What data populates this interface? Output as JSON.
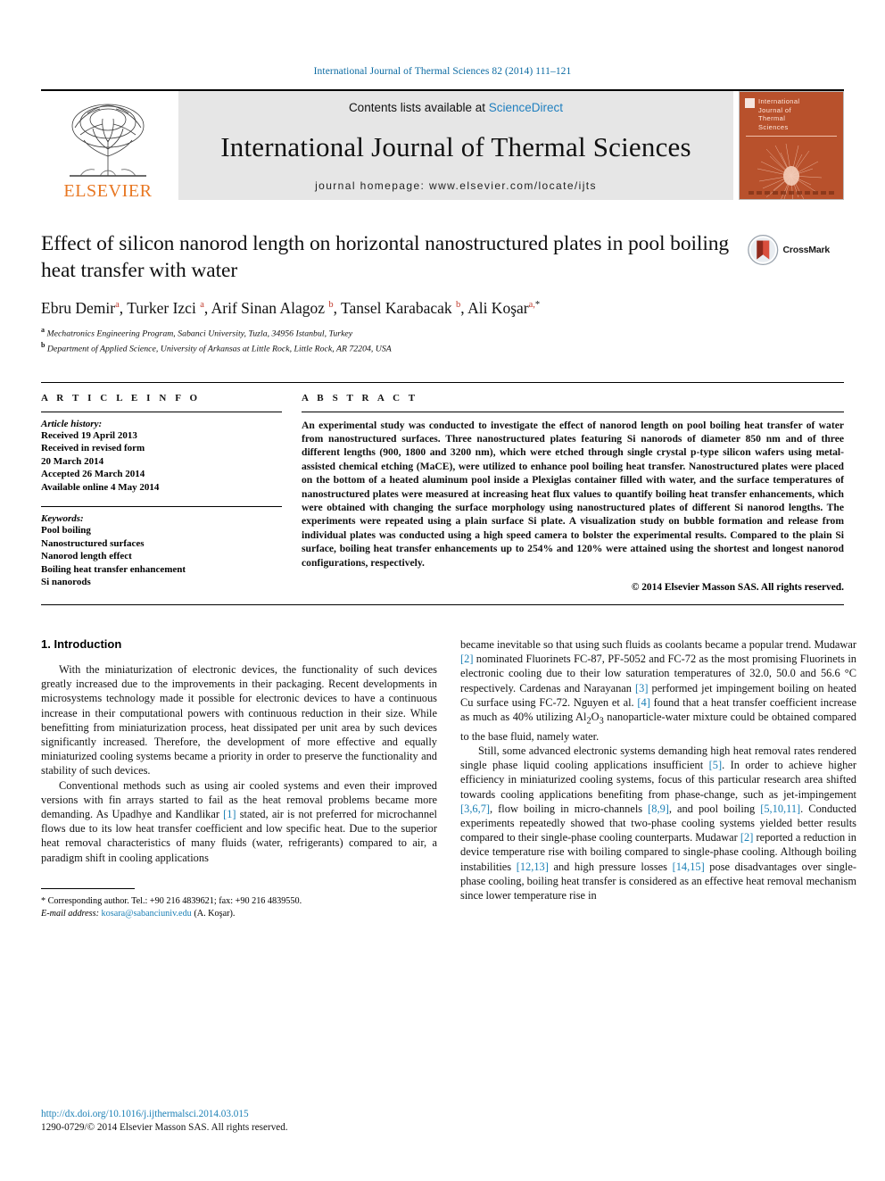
{
  "running_head": "International Journal of Thermal Sciences 82 (2014) 111–121",
  "masthead": {
    "publisher_name": "ELSEVIER",
    "contents_prefix": "Contents lists available at ",
    "contents_link": "ScienceDirect",
    "journal_title": "International Journal of Thermal Sciences",
    "homepage_line": "journal homepage: www.elsevier.com/locate/ijts",
    "cover_title_lines": [
      "International",
      "Journal of",
      "Thermal",
      "Sciences"
    ]
  },
  "article": {
    "title": "Effect of silicon nanorod length on horizontal nanostructured plates in pool boiling heat transfer with water",
    "crossmark_label": "CrossMark",
    "authors_html": "Ebru Demir<sup>a</sup>, Turker Izci <sup>a</sup>, Arif Sinan Alagoz <sup>b</sup>, Tansel Karabacak <sup>b</sup>, Ali Koşar<sup>a,</sup><sup class=\"star\">*</sup>",
    "affiliations": [
      "<sup>a</sup> Mechatronics Engineering Program, Sabanci University, Tuzla, 34956 Istanbul, Turkey",
      "<sup>b</sup> Department of Applied Science, University of Arkansas at Little Rock, Little Rock, AR 72204, USA"
    ]
  },
  "info": {
    "heading": "A R T I C L E   I N F O",
    "history_label": "Article history:",
    "history_lines": [
      "Received 19 April 2013",
      "Received in revised form",
      "20 March 2014",
      "Accepted 26 March 2014",
      "Available online 4 May 2014"
    ],
    "keywords_label": "Keywords:",
    "keywords": [
      "Pool boiling",
      "Nanostructured surfaces",
      "Nanorod length effect",
      "Boiling heat transfer enhancement",
      "Si nanorods"
    ]
  },
  "abstract": {
    "heading": "A B S T R A C T",
    "text": "An experimental study was conducted to investigate the effect of nanorod length on pool boiling heat transfer of water from nanostructured surfaces. Three nanostructured plates featuring Si nanorods of diameter 850 nm and of three different lengths (900, 1800 and 3200 nm), which were etched through single crystal p-type silicon wafers using metal-assisted chemical etching (MaCE), were utilized to enhance pool boiling heat transfer. Nanostructured plates were placed on the bottom of a heated aluminum pool inside a Plexiglas container filled with water, and the surface temperatures of nanostructured plates were measured at increasing heat flux values to quantify boiling heat transfer enhancements, which were obtained with changing the surface morphology using nanostructured plates of different Si nanorod lengths. The experiments were repeated using a plain surface Si plate. A visualization study on bubble formation and release from individual plates was conducted using a high speed camera to bolster the experimental results. Compared to the plain Si surface, boiling heat transfer enhancements up to 254% and 120% were attained using the shortest and longest nanorod configurations, respectively.",
    "copyright": "© 2014 Elsevier Masson SAS. All rights reserved."
  },
  "body": {
    "section_number_title": "1.  Introduction",
    "left_paragraphs_html": [
      "With the miniaturization of electronic devices, the functionality of such devices greatly increased due to the improvements in their packaging. Recent developments in microsystems technology made it possible for electronic devices to have a continuous increase in their computational powers with continuous reduction in their size. While benefitting from miniaturization process, heat dissipated per unit area by such devices significantly increased. Therefore, the development of more effective and equally miniaturized cooling systems became a priority in order to preserve the functionality and stability of such devices.",
      "Conventional methods such as using air cooled systems and even their improved versions with fin arrays started to fail as the heat removal problems became more demanding. As Upadhye and Kandlikar <span class=\"ref\">[1]</span> stated, air is not preferred for microchannel flows due to its low heat transfer coefficient and low specific heat. Due to the superior heat removal characteristics of many fluids (water, refrigerants) compared to air, a paradigm shift in cooling applications"
    ],
    "right_paragraphs_html": [
      "became inevitable so that using such fluids as coolants became a popular trend. Mudawar <span class=\"ref\">[2]</span> nominated Fluorinets FC-87, PF-5052 and FC-72 as the most promising Fluorinets in electronic cooling due to their low saturation temperatures of 32.0, 50.0 and 56.6 °C respectively. Cardenas and Narayanan <span class=\"ref\">[3]</span> performed jet impingement boiling on heated Cu surface using FC-72. Nguyen et al. <span class=\"ref\">[4]</span> found that a heat transfer coefficient increase as much as 40% utilizing Al<sub>2</sub>O<sub>3</sub> nanoparticle-water mixture could be obtained compared to the base fluid, namely water.",
      "Still, some advanced electronic systems demanding high heat removal rates rendered single phase liquid cooling applications insufficient <span class=\"ref\">[5]</span>. In order to achieve higher efficiency in miniaturized cooling systems, focus of this particular research area shifted towards cooling applications benefiting from phase-change, such as jet-impingement <span class=\"ref\">[3,6,7]</span>, flow boiling in micro-channels <span class=\"ref\">[8,9]</span>, and pool boiling <span class=\"ref\">[5,10,11]</span>. Conducted experiments repeatedly showed that two-phase cooling systems yielded better results compared to their single-phase cooling counterparts. Mudawar <span class=\"ref\">[2]</span> reported a reduction in device temperature rise with boiling compared to single-phase cooling. Although boiling instabilities <span class=\"ref\">[12,13]</span> and high pressure losses <span class=\"ref\">[14,15]</span> pose disadvantages over single-phase cooling, boiling heat transfer is considered as an effective heat removal mechanism since lower temperature rise in"
    ]
  },
  "footnote": {
    "corresponding_html": "* Corresponding author. Tel.: +90 216 4839621; fax: +90 216 4839550.",
    "email_html": "<span class=\"em\">E-mail address:</span> <span class=\"lnk\">kosara@sabanciuniv.edu</span> (A. Koşar)."
  },
  "footer": {
    "doi": "http://dx.doi.org/10.1016/j.ijthermalsci.2014.03.015",
    "issn_line": "1290-0729/© 2014 Elsevier Masson SAS. All rights reserved."
  },
  "colors": {
    "link_blue": "#1a7fb5",
    "running_head_blue": "#0b6aa2",
    "elsevier_orange": "#e87722",
    "cover_orange": "#b8512c"
  }
}
